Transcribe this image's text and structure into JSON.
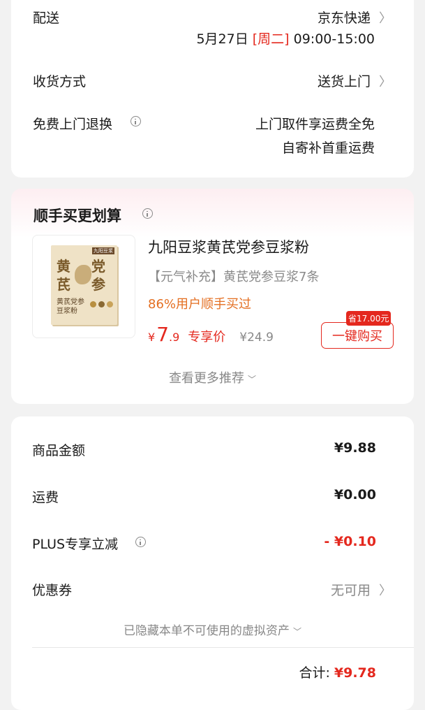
{
  "delivery": {
    "label": "配送",
    "carrier": "京东快递",
    "date": "5月27日",
    "weekday": "[周二]",
    "time": "09:00-15:00"
  },
  "receive": {
    "label": "收货方式",
    "value": "送货上门"
  },
  "return_service": {
    "label": "免费上门退换",
    "line1": "上门取件享运费全免",
    "line2": "自寄补首重运费"
  },
  "recommend": {
    "title": "顺手买更划算",
    "product": {
      "name": "九阳豆浆黄芪党参豆浆粉",
      "tagline": "【元气补充】黄芪党参豆浆7条",
      "buy_rate": "86%用户顺手买过",
      "currency": "¥",
      "price_int": "7",
      "price_dec": ".9",
      "price_tag": "专享价",
      "original_price": "¥24.9",
      "save_badge": "省17.00元",
      "buy_button": "一键购买",
      "image_text": {
        "brand": "九阳豆浆",
        "big1": "黄",
        "big2": "芪",
        "big3": "党",
        "big4": "参",
        "sub1": "黄芪党参",
        "sub2": "豆浆粉"
      }
    },
    "more_link": "查看更多推荐"
  },
  "summary": {
    "goods_label": "商品金额",
    "goods_value": "¥9.88",
    "shipping_label": "运费",
    "shipping_value": "¥0.00",
    "plus_label": "PLUS专享立减",
    "plus_value": "- ¥0.10",
    "coupon_label": "优惠券",
    "coupon_value": "无可用",
    "hidden_note": "已隐藏本单不可使用的虚拟资产",
    "total_label": "合计:",
    "total_value": "¥9.78"
  },
  "colors": {
    "accent_red": "#e4281e",
    "orange": "#e46f22"
  }
}
